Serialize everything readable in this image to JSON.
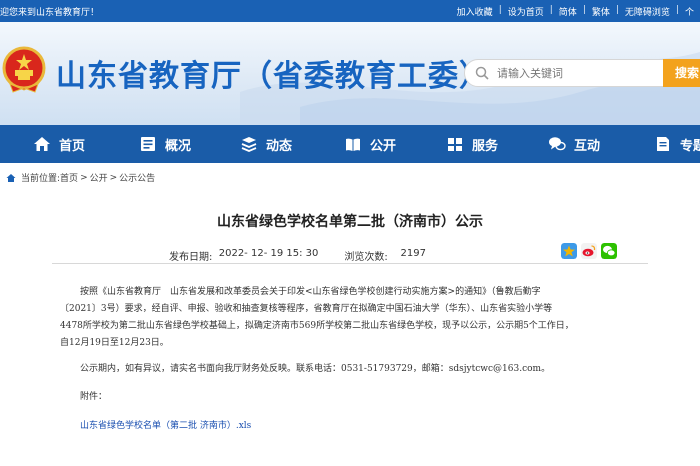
{
  "topbar": {
    "welcome": "迎您来到山东省教育厅！",
    "links": [
      "加入收藏",
      "设为首页",
      "简体",
      "繁体",
      "无障碍浏览",
      "个"
    ]
  },
  "header": {
    "title": "山东省教育厅（省委教育工委）",
    "search_placeholder": "请输入关键词",
    "search_button": "搜索"
  },
  "nav": {
    "items": [
      {
        "label": "首页",
        "icon": "home-icon"
      },
      {
        "label": "概况",
        "icon": "overview-icon"
      },
      {
        "label": "动态",
        "icon": "news-icon"
      },
      {
        "label": "公开",
        "icon": "disclosure-icon"
      },
      {
        "label": "服务",
        "icon": "service-icon"
      },
      {
        "label": "互动",
        "icon": "interaction-icon"
      },
      {
        "label": "专题",
        "icon": "topic-icon"
      }
    ]
  },
  "breadcrumb": {
    "prefix": "当前位置:",
    "items": [
      "首页",
      "公开",
      "公示公告"
    ],
    "separator": ">"
  },
  "article": {
    "title": "山东省绿色学校名单第二批（济南市）公示",
    "date_label": "发布日期:",
    "date_value": "2022- 12- 19 15: 30",
    "views_label": "浏览次数:",
    "views_value": "2197",
    "share_icons": [
      "qzone-icon",
      "weibo-icon",
      "wechat-icon"
    ],
    "share_colors": {
      "qzone": "#f0b400",
      "weibo": "#e6162d",
      "wechat": "#2dc100"
    },
    "paragraph1_line1": "按照《山东省教育厅　山东省发展和改革委员会关于印发<山东省绿色学校创建行动实施方案>的通知》（鲁教后勤字",
    "paragraph1_line2": "〔2021〕3号）要求，经自评、申报、验收和抽查复核等程序，省教育厅在拟确定中国石油大学（华东）、山东省实验小学等",
    "paragraph1_line3": "4478所学校为第二批山东省绿色学校基础上，拟确定济南市569所学校第二批山东省绿色学校，现予以公示，公示期5个工作日，",
    "paragraph1_line4": "自12月19日至12月23日。",
    "paragraph2": "公示期内，如有异议，请实名书面向我厅财务处反映。联系电话：0531-51793729，邮箱：sdsjytcwc@163.com。",
    "attachment_label": "附件：",
    "attachment_link": "山东省绿色学校名单（第二批 济南市）.xls"
  },
  "colors": {
    "topbar": "#1a61b4",
    "nav": "#1a5ca8",
    "title_blue": "#1764c0",
    "search_orange": "#f3a21c",
    "link_blue": "#1a4fb0"
  }
}
